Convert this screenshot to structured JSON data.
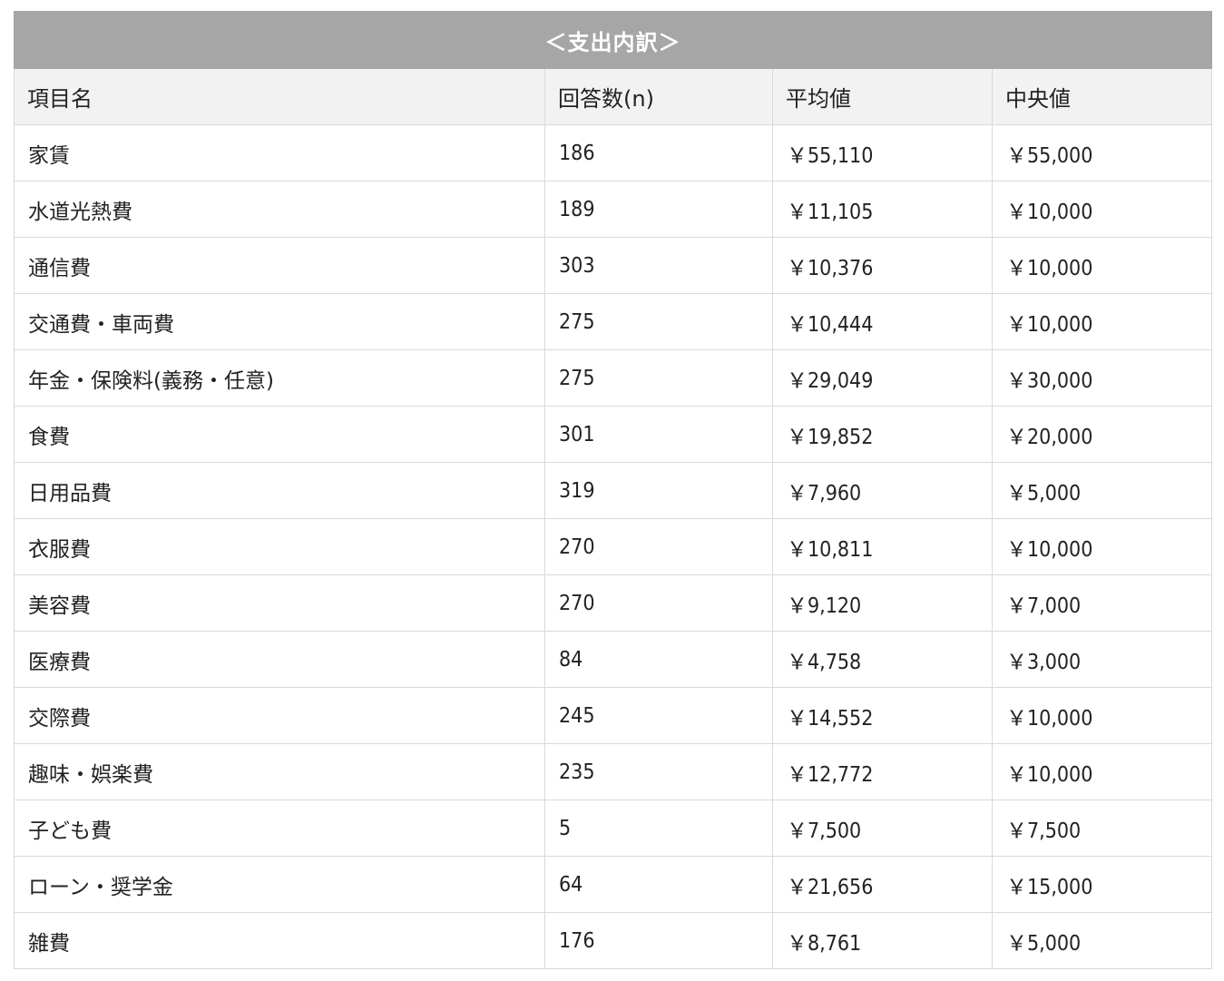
{
  "table": {
    "title": "＜支出内訳＞",
    "headers": [
      "項目名",
      "回答数(n)",
      "平均値",
      "中央値"
    ],
    "rows": [
      {
        "item": "家賃",
        "n": "186",
        "mean": "￥55,110",
        "median": "￥55,000"
      },
      {
        "item": "水道光熱費",
        "n": "189",
        "mean": "￥11,105",
        "median": "￥10,000"
      },
      {
        "item": "通信費",
        "n": "303",
        "mean": "￥10,376",
        "median": "￥10,000"
      },
      {
        "item": "交通費・車両費",
        "n": "275",
        "mean": "￥10,444",
        "median": "￥10,000"
      },
      {
        "item": "年金・保険料(義務・任意)",
        "n": "275",
        "mean": "￥29,049",
        "median": "￥30,000"
      },
      {
        "item": "食費",
        "n": "301",
        "mean": "￥19,852",
        "median": "￥20,000"
      },
      {
        "item": "日用品費",
        "n": "319",
        "mean": "￥7,960",
        "median": "￥5,000"
      },
      {
        "item": "衣服費",
        "n": "270",
        "mean": "￥10,811",
        "median": "￥10,000"
      },
      {
        "item": "美容費",
        "n": "270",
        "mean": "￥9,120",
        "median": "￥7,000"
      },
      {
        "item": "医療費",
        "n": "84",
        "mean": "￥4,758",
        "median": "￥3,000"
      },
      {
        "item": "交際費",
        "n": "245",
        "mean": "￥14,552",
        "median": "￥10,000"
      },
      {
        "item": "趣味・娯楽費",
        "n": "235",
        "mean": "￥12,772",
        "median": "￥10,000"
      },
      {
        "item": "子ども費",
        "n": "5",
        "mean": "￥7,500",
        "median": "￥7,500"
      },
      {
        "item": "ローン・奨学金",
        "n": "64",
        "mean": "￥21,656",
        "median": "￥15,000"
      },
      {
        "item": "雑費",
        "n": "176",
        "mean": "￥8,761",
        "median": "￥5,000"
      }
    ]
  }
}
